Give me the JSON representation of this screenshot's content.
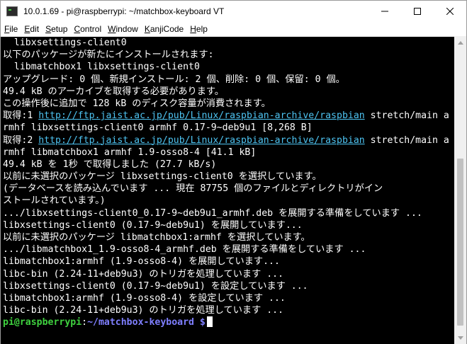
{
  "window": {
    "title": "10.0.1.69 - pi@raspberrypi: ~/matchbox-keyboard VT"
  },
  "menu": {
    "items": [
      "File",
      "Edit",
      "Setup",
      "Control",
      "Window",
      "KanjiCode",
      "Help"
    ],
    "mnemonics": [
      "F",
      "E",
      "S",
      "C",
      "W",
      "K",
      "H"
    ]
  },
  "terminal": {
    "lines": [
      [
        {
          "t": "  libxsettings-client0"
        }
      ],
      [
        {
          "t": "以下のパッケージが新たにインストールされます:"
        }
      ],
      [
        {
          "t": "  libmatchbox1 libxsettings-client0"
        }
      ],
      [
        {
          "t": "アップグレード: 0 個、新規インストール: 2 個、削除: 0 個、保留: 0 個。"
        }
      ],
      [
        {
          "t": "49.4 kB のアーカイブを取得する必要があります。"
        }
      ],
      [
        {
          "t": "この操作後に追加で 128 kB のディスク容量が消費されます。"
        }
      ],
      [
        {
          "t": "取得:1 "
        },
        {
          "t": "http://ftp.jaist.ac.jp/pub/Linux/raspbian-archive/raspbian",
          "c": "link"
        },
        {
          "t": " stretch/main a"
        }
      ],
      [
        {
          "t": "rmhf libxsettings-client0 armhf 0.17-9~deb9u1 [8,268 B]"
        }
      ],
      [
        {
          "t": "取得:2 "
        },
        {
          "t": "http://ftp.jaist.ac.jp/pub/Linux/raspbian-archive/raspbian",
          "c": "link"
        },
        {
          "t": " stretch/main a"
        }
      ],
      [
        {
          "t": "rmhf libmatchbox1 armhf 1.9-osso8-4 [41.1 kB]"
        }
      ],
      [
        {
          "t": "49.4 kB を 1秒 で取得しました (27.7 kB/s)"
        }
      ],
      [
        {
          "t": "以前に未選択のパッケージ libxsettings-client0 を選択しています。"
        }
      ],
      [
        {
          "t": "(データベースを読み込んでいます ... 現在 87755 個のファイルとディレクトリがイン"
        }
      ],
      [
        {
          "t": "ストールされています。)"
        }
      ],
      [
        {
          "t": ".../libxsettings-client0_0.17-9~deb9u1_armhf.deb を展開する準備をしています ..."
        }
      ],
      [
        {
          "t": "libxsettings-client0 (0.17-9~deb9u1) を展開しています..."
        }
      ],
      [
        {
          "t": "以前に未選択のパッケージ libmatchbox1:armhf を選択しています。"
        }
      ],
      [
        {
          "t": ".../libmatchbox1_1.9-osso8-4_armhf.deb を展開する準備をしています ..."
        }
      ],
      [
        {
          "t": "libmatchbox1:armhf (1.9-osso8-4) を展開しています..."
        }
      ],
      [
        {
          "t": "libc-bin (2.24-11+deb9u3) のトリガを処理しています ..."
        }
      ],
      [
        {
          "t": "libxsettings-client0 (0.17-9~deb9u1) を設定しています ..."
        }
      ],
      [
        {
          "t": "libmatchbox1:armhf (1.9-osso8-4) を設定しています ..."
        }
      ],
      [
        {
          "t": "libc-bin (2.24-11+deb9u3) のトリガを処理しています ..."
        }
      ]
    ],
    "prompt": {
      "user_host": "pi@raspberrypi",
      "separator": ":",
      "path": "~/matchbox-keyboard",
      "symbol": " $"
    }
  },
  "colors": {
    "terminal_bg": "#000000",
    "terminal_fg": "#ffffff",
    "link": "#4ec4f2",
    "prompt_user": "#3fd13f",
    "prompt_path": "#7f7fff"
  },
  "icons": {
    "app": "terminal-icon",
    "minimize": "minimize-icon",
    "maximize": "maximize-icon",
    "close": "close-icon",
    "scroll_up": "scroll-up-arrow-icon",
    "scroll_down": "scroll-down-arrow-icon"
  }
}
